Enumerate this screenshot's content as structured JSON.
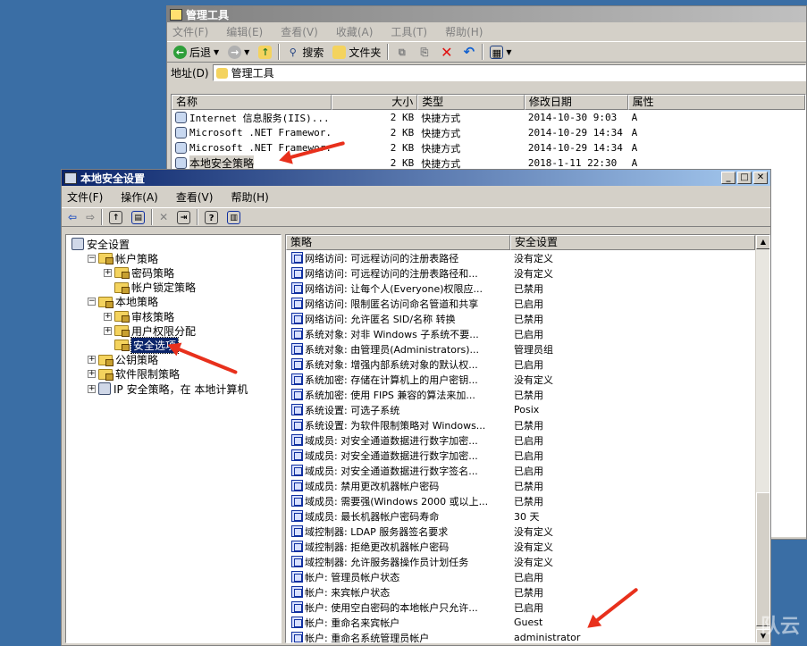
{
  "admin_window": {
    "title": "管理工具",
    "menu": [
      "文件(F)",
      "编辑(E)",
      "查看(V)",
      "收藏(A)",
      "工具(T)",
      "帮助(H)"
    ],
    "toolbar": {
      "back": "后退",
      "search": "搜索",
      "folders": "文件夹"
    },
    "address_label": "地址(D)",
    "address_value": "管理工具",
    "columns": [
      "名称",
      "大小",
      "类型",
      "修改日期",
      "属性"
    ],
    "rows": [
      {
        "name": "Internet 信息服务(IIS)...",
        "size": "2 KB",
        "type": "快捷方式",
        "date": "2014-10-30 9:03",
        "attr": "A"
      },
      {
        "name": "Microsoft .NET Framewor...",
        "size": "2 KB",
        "type": "快捷方式",
        "date": "2014-10-29 14:34",
        "attr": "A"
      },
      {
        "name": "Microsoft .NET Framewor...",
        "size": "2 KB",
        "type": "快捷方式",
        "date": "2014-10-29 14:34",
        "attr": "A"
      },
      {
        "name": "本地安全策略",
        "size": "2 KB",
        "type": "快捷方式",
        "date": "2018-1-11 22:30",
        "attr": "A"
      }
    ]
  },
  "secpol_window": {
    "title": "本地安全设置",
    "menu": [
      "文件(F)",
      "操作(A)",
      "查看(V)",
      "帮助(H)"
    ],
    "tree": [
      {
        "label": "安全设置",
        "level": 0,
        "toggle": "",
        "icon": "shield"
      },
      {
        "label": "帐户策略",
        "level": 1,
        "toggle": "−",
        "icon": "folder"
      },
      {
        "label": "密码策略",
        "level": 2,
        "toggle": "+",
        "icon": "folder"
      },
      {
        "label": "帐户锁定策略",
        "level": 2,
        "toggle": "",
        "icon": "folder"
      },
      {
        "label": "本地策略",
        "level": 1,
        "toggle": "−",
        "icon": "folder"
      },
      {
        "label": "审核策略",
        "level": 2,
        "toggle": "+",
        "icon": "folder"
      },
      {
        "label": "用户权限分配",
        "level": 2,
        "toggle": "+",
        "icon": "folder"
      },
      {
        "label": "安全选项",
        "level": 2,
        "toggle": "",
        "icon": "folder",
        "selected": true
      },
      {
        "label": "公钥策略",
        "level": 1,
        "toggle": "+",
        "icon": "folder"
      },
      {
        "label": "软件限制策略",
        "level": 1,
        "toggle": "+",
        "icon": "folder"
      },
      {
        "label": "IP 安全策略，在 本地计算机",
        "level": 1,
        "toggle": "+",
        "icon": "shield"
      }
    ],
    "columns": [
      "策略",
      "安全设置"
    ],
    "policies": [
      {
        "name": "网络访问: 可远程访问的注册表路径",
        "value": "没有定义"
      },
      {
        "name": "网络访问: 可远程访问的注册表路径和...",
        "value": "没有定义"
      },
      {
        "name": "网络访问: 让每个人(Everyone)权限应...",
        "value": "已禁用"
      },
      {
        "name": "网络访问: 限制匿名访问命名管道和共享",
        "value": "已启用"
      },
      {
        "name": "网络访问: 允许匿名 SID/名称 转换",
        "value": "已禁用"
      },
      {
        "name": "系统对象: 对非 Windows 子系统不要...",
        "value": "已启用"
      },
      {
        "name": "系统对象: 由管理员(Administrators)...",
        "value": "管理员组"
      },
      {
        "name": "系统对象: 增强内部系统对象的默认权...",
        "value": "已启用"
      },
      {
        "name": "系统加密: 存储在计算机上的用户密钥...",
        "value": "没有定义"
      },
      {
        "name": "系统加密: 使用 FIPS 兼容的算法来加...",
        "value": "已禁用"
      },
      {
        "name": "系统设置: 可选子系统",
        "value": "Posix"
      },
      {
        "name": "系统设置: 为软件限制策略对 Windows...",
        "value": "已禁用"
      },
      {
        "name": "域成员: 对安全通道数据进行数字加密...",
        "value": "已启用"
      },
      {
        "name": "域成员: 对安全通道数据进行数字加密...",
        "value": "已启用"
      },
      {
        "name": "域成员: 对安全通道数据进行数字签名...",
        "value": "已启用"
      },
      {
        "name": "域成员: 禁用更改机器帐户密码",
        "value": "已禁用"
      },
      {
        "name": "域成员: 需要强(Windows 2000 或以上...",
        "value": "已禁用"
      },
      {
        "name": "域成员: 最长机器帐户密码寿命",
        "value": "30 天"
      },
      {
        "name": "域控制器: LDAP 服务器签名要求",
        "value": "没有定义"
      },
      {
        "name": "域控制器: 拒绝更改机器帐户密码",
        "value": "没有定义"
      },
      {
        "name": "域控制器: 允许服务器操作员计划任务",
        "value": "没有定义"
      },
      {
        "name": "帐户: 管理员帐户状态",
        "value": "已启用"
      },
      {
        "name": "帐户: 来宾帐户状态",
        "value": "已禁用"
      },
      {
        "name": "帐户: 使用空白密码的本地帐户只允许...",
        "value": "已启用"
      },
      {
        "name": "帐户: 重命名来宾帐户",
        "value": "Guest"
      },
      {
        "name": "帐户: 重命名系统管理员帐户",
        "value": "administrator"
      }
    ]
  },
  "watermark": "队云"
}
